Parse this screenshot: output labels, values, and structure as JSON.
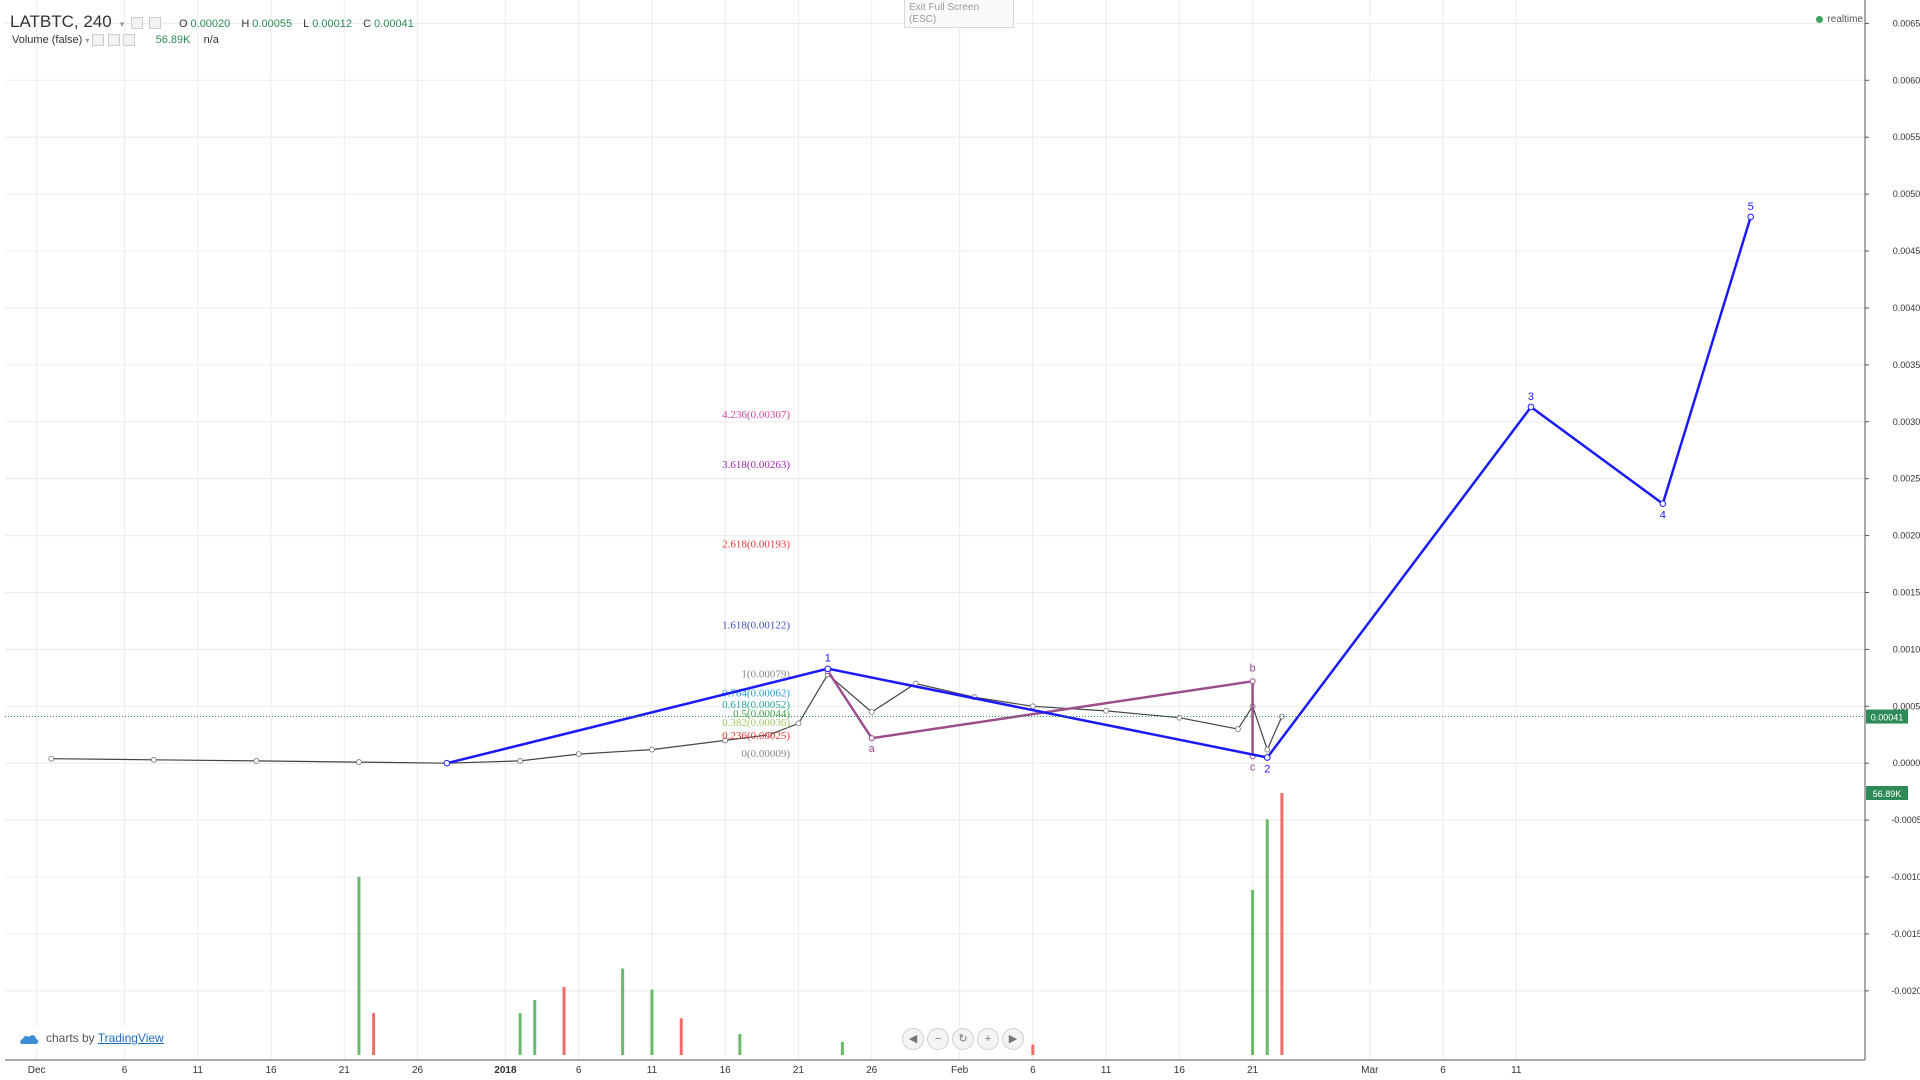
{
  "header": {
    "symbol": "LATBTC, 240",
    "ohlc": [
      {
        "label": "O",
        "value": "0.00020"
      },
      {
        "label": "H",
        "value": "0.00055"
      },
      {
        "label": "L",
        "value": "0.00012"
      },
      {
        "label": "C",
        "value": "0.00041"
      }
    ],
    "volume_label": "Volume (false)",
    "volume_value": "56.89K",
    "volume_na": "n/a"
  },
  "exit_fullscreen": {
    "label": "Exit Full Screen",
    "hint": "(ESC)"
  },
  "realtime_label": "realtime",
  "branding": {
    "prefix": "charts by",
    "link": "TradingView"
  },
  "nav_icons": [
    "arrow-left-icon",
    "zoom-out-icon",
    "reset-icon",
    "zoom-in-icon",
    "arrow-right-icon"
  ],
  "colors": {
    "wave_line": "#1a1aff",
    "correction_line": "#9b4d8c",
    "up_candle": "#4caf50",
    "down_candle": "#ef5350",
    "price_tag": "#2e8b57"
  },
  "chart_data": {
    "type": "line",
    "title": "LATBTC, 240",
    "price_axis": {
      "ylim": [
        -0.0023,
        0.0066
      ],
      "ticks": [
        "0.00650",
        "0.00600",
        "0.00550",
        "0.00500",
        "0.00450",
        "0.00400",
        "0.00350",
        "0.00300",
        "0.00250",
        "0.00200",
        "0.00150",
        "0.00100",
        "0.00050",
        "0.00000",
        "-0.00050",
        "-0.00100",
        "-0.00150",
        "-0.00200"
      ],
      "current_price": "0.00041",
      "volume_tag": "56.89K"
    },
    "time_axis": {
      "ticks": [
        "Dec",
        "6",
        "11",
        "16",
        "21",
        "26",
        "2018",
        "6",
        "11",
        "16",
        "21",
        "26",
        "Feb",
        "6",
        "11",
        "16",
        "21",
        "Mar",
        "6",
        "11"
      ],
      "bold_tick": "2018"
    },
    "grid": true,
    "elliott_wave": {
      "name": "impulse",
      "points": [
        {
          "label": "",
          "date": "2017-12-28",
          "price": 0.0
        },
        {
          "label": "1",
          "date": "2018-01-23",
          "price": 0.00083
        },
        {
          "label": "2",
          "date": "2018-02-22",
          "price": 5e-05
        },
        {
          "label": "3",
          "date": "2018-03-12",
          "price": 0.00313
        },
        {
          "label": "4",
          "date": "2018-03-21",
          "price": 0.00228
        },
        {
          "label": "5",
          "date": "2018-03-27",
          "price": 0.0048
        }
      ]
    },
    "correction": {
      "points": [
        {
          "label": "",
          "date": "2018-01-23",
          "price": 0.00081
        },
        {
          "label": "a",
          "date": "2018-01-26",
          "price": 0.00022
        },
        {
          "label": "b",
          "date": "2018-02-21",
          "price": 0.00072
        },
        {
          "label": "c",
          "date": "2018-02-21",
          "price": 6e-05
        }
      ]
    },
    "fib_levels": [
      {
        "label": "4.236(0.00307)",
        "value": 0.00307,
        "color": "#d6409f"
      },
      {
        "label": "3.618(0.00263)",
        "value": 0.00263,
        "color": "#9c27b0"
      },
      {
        "label": "2.618(0.00193)",
        "value": 0.00193,
        "color": "#e53935"
      },
      {
        "label": "1.618(0.00122)",
        "value": 0.00122,
        "color": "#3f51b5"
      },
      {
        "label": "1(0.00079)",
        "value": 0.00079,
        "color": "#888888"
      },
      {
        "label": "0.764(0.00062)",
        "value": 0.00062,
        "color": "#26a0da"
      },
      {
        "label": "0.618(0.00052)",
        "value": 0.00052,
        "color": "#26a69a"
      },
      {
        "label": "0.5(0.00044)",
        "value": 0.00044,
        "color": "#43a047"
      },
      {
        "label": "0.382(0.00036)",
        "value": 0.00036,
        "color": "#9ccc65"
      },
      {
        "label": "0.236(0.00025)",
        "value": 0.00025,
        "color": "#e53935"
      },
      {
        "label": "0(0.00009)",
        "value": 9e-05,
        "color": "#888888"
      }
    ],
    "price_series": [
      {
        "date": "2017-12-01",
        "price": 4e-05
      },
      {
        "date": "2017-12-08",
        "price": 3e-05
      },
      {
        "date": "2017-12-15",
        "price": 2e-05
      },
      {
        "date": "2017-12-22",
        "price": 1e-05
      },
      {
        "date": "2017-12-28",
        "price": 0.0
      },
      {
        "date": "2018-01-02",
        "price": 2e-05
      },
      {
        "date": "2018-01-06",
        "price": 8e-05
      },
      {
        "date": "2018-01-11",
        "price": 0.00012
      },
      {
        "date": "2018-01-16",
        "price": 0.0002
      },
      {
        "date": "2018-01-19",
        "price": 0.00025
      },
      {
        "date": "2018-01-21",
        "price": 0.00035
      },
      {
        "date": "2018-01-23",
        "price": 0.00078
      },
      {
        "date": "2018-01-26",
        "price": 0.00045
      },
      {
        "date": "2018-01-29",
        "price": 0.0007
      },
      {
        "date": "2018-02-02",
        "price": 0.00058
      },
      {
        "date": "2018-02-06",
        "price": 0.0005
      },
      {
        "date": "2018-02-11",
        "price": 0.00046
      },
      {
        "date": "2018-02-16",
        "price": 0.0004
      },
      {
        "date": "2018-02-20",
        "price": 0.0003
      },
      {
        "date": "2018-02-21",
        "price": 0.0005
      },
      {
        "date": "2018-02-22",
        "price": 0.00012
      },
      {
        "date": "2018-02-23",
        "price": 0.00041
      }
    ],
    "volume_series": [
      {
        "date": "2017-12-22",
        "volume": 0.68
      },
      {
        "date": "2017-12-23",
        "volume": 0.16
      },
      {
        "date": "2018-01-02",
        "volume": 0.16
      },
      {
        "date": "2018-01-03",
        "volume": 0.21
      },
      {
        "date": "2018-01-05",
        "volume": 0.26
      },
      {
        "date": "2018-01-09",
        "volume": 0.33
      },
      {
        "date": "2018-01-11",
        "volume": 0.25
      },
      {
        "date": "2018-01-13",
        "volume": 0.14
      },
      {
        "date": "2018-01-17",
        "volume": 0.08
      },
      {
        "date": "2018-01-24",
        "volume": 0.05
      },
      {
        "date": "2018-02-06",
        "volume": 0.04
      },
      {
        "date": "2018-02-21",
        "volume": 0.63
      },
      {
        "date": "2018-02-22",
        "volume": 0.9
      },
      {
        "date": "2018-02-23",
        "volume": 1.0
      }
    ]
  }
}
